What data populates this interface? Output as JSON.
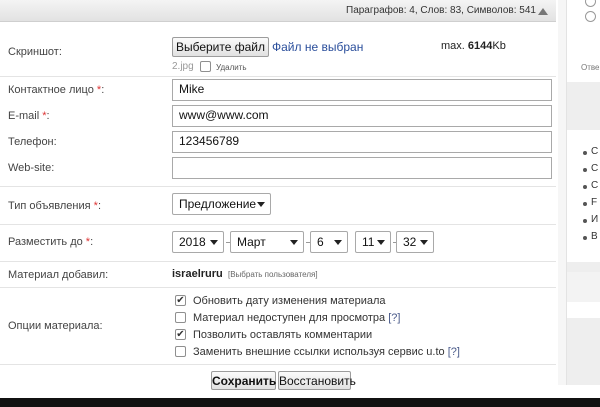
{
  "status_bar": {
    "stats": "Параграфов: 4, Слов: 83, Символов: 541"
  },
  "screenshot": {
    "label": "Скриншот:",
    "choose_button": "Выберите файл",
    "no_file": "Файл не выбран",
    "max_prefix": "max.",
    "max_value": "6144",
    "max_unit": "Kb",
    "current_file": "2.jpg",
    "delete_label": "Удалить"
  },
  "contact": {
    "label": "Контактное лицо",
    "value": "Mike"
  },
  "email": {
    "label": "E-mail",
    "value": "www@www.com"
  },
  "phone": {
    "label": "Телефон:",
    "value": "123456789"
  },
  "website": {
    "label": "Web-site:",
    "value": ""
  },
  "ad_type": {
    "label": "Тип объявления",
    "selected": "Предложение"
  },
  "place_until": {
    "label": "Разместить до",
    "year": "2018",
    "month": "Март",
    "day": "6",
    "hour": "11",
    "minute": "32"
  },
  "added_by": {
    "label": "Материал добавил:",
    "user": "israelruru",
    "choose_user": "[Выбрать пользователя]"
  },
  "options": {
    "label": "Опции материала:",
    "items": [
      {
        "text": "Обновить дату изменения материала",
        "checked": true,
        "help": ""
      },
      {
        "text": "Материал недоступен для просмотра",
        "checked": false,
        "help": "[?]"
      },
      {
        "text": "Позволить оставлять комментарии",
        "checked": true,
        "help": ""
      },
      {
        "text": "Заменить внешние ссылки используя сервис u.to",
        "checked": false,
        "help": "[?]"
      }
    ]
  },
  "actions": {
    "save": "Сохранить",
    "reset": "Восстановить"
  },
  "side_panel": {
    "caption": "Отве",
    "list_letters": [
      "С",
      "С",
      "С",
      "F",
      "И",
      "В"
    ]
  },
  "required_mark": "*"
}
